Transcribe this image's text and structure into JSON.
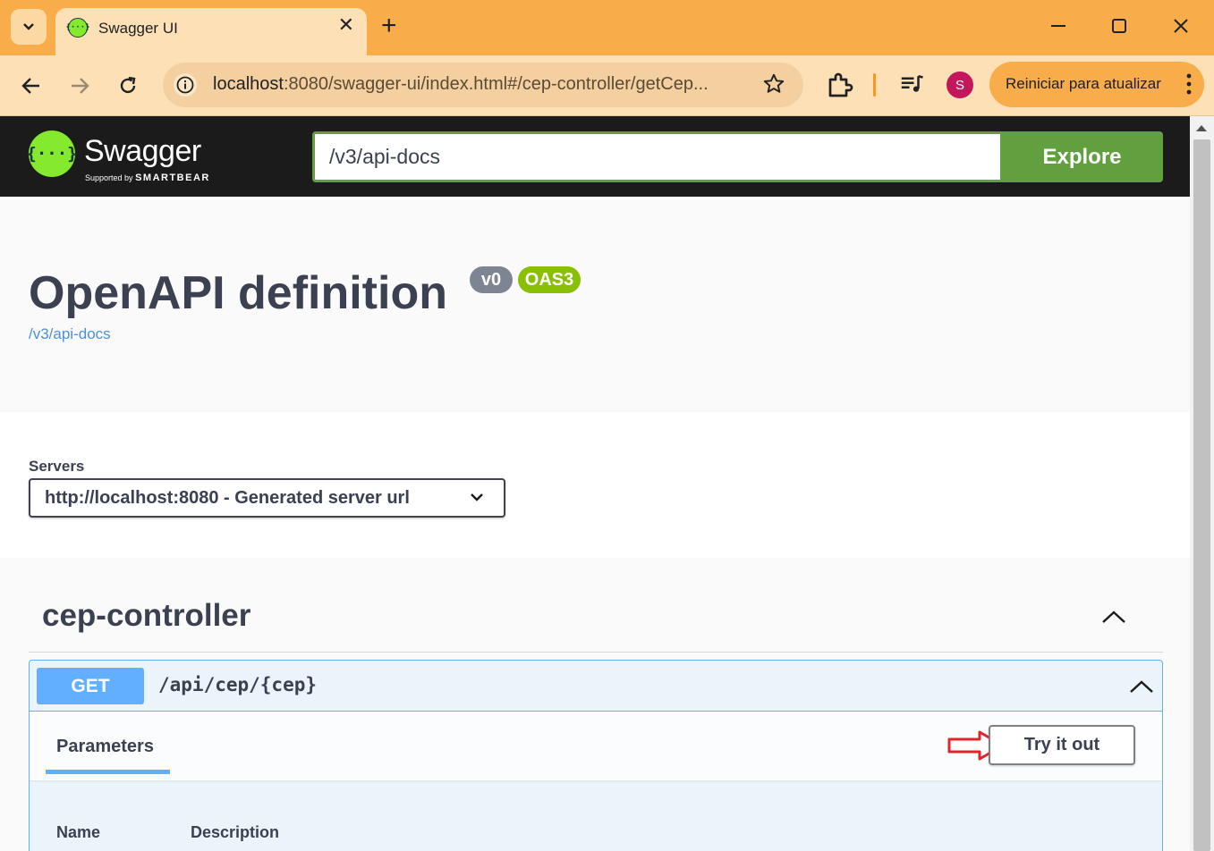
{
  "browser": {
    "tab_title": "Swagger UI",
    "url_host": "localhost",
    "url_rest": ":8080/swagger-ui/index.html#/cep-controller/getCep...",
    "update_button": "Reiniciar para atualizar",
    "avatar_letter": "S",
    "accent_color": "#f9ac4a"
  },
  "swagger": {
    "logo_text": "Swagger",
    "logo_sub_prefix": "Supported by",
    "logo_sub_brand": "SMARTBEAR",
    "url_input_value": "/v3/api-docs",
    "explore_label": "Explore"
  },
  "info": {
    "title": "OpenAPI definition",
    "version_badge": "v0",
    "spec_badge": "OAS3",
    "spec_link": "/v3/api-docs"
  },
  "servers": {
    "label": "Servers",
    "selected": "http://localhost:8080 - Generated server url"
  },
  "tag": {
    "name": "cep-controller"
  },
  "operation": {
    "method": "GET",
    "path": "/api/cep/{cep}",
    "params_tab": "Parameters",
    "try_it_out": "Try it out",
    "columns": [
      "Name",
      "Description"
    ]
  }
}
